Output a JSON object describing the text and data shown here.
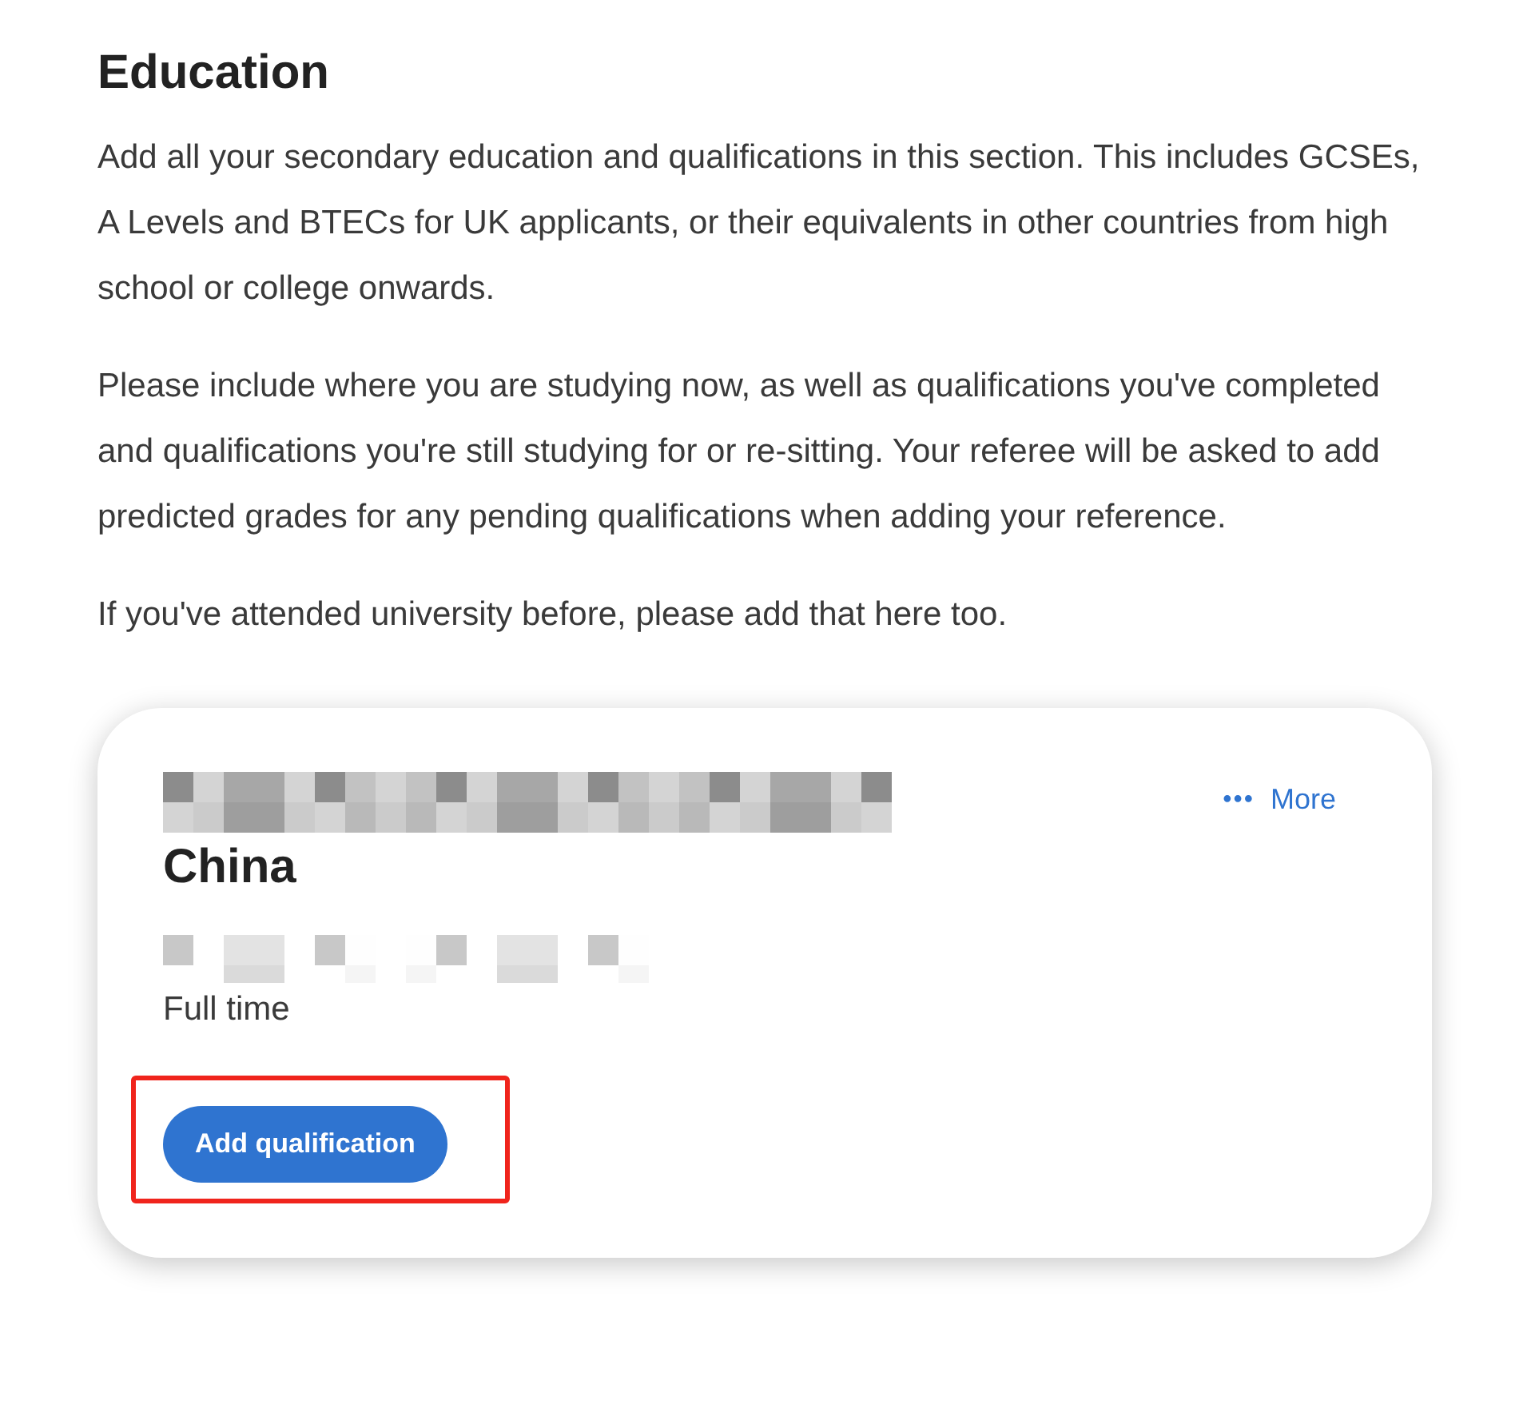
{
  "heading": "Education",
  "paragraphs": [
    "Add all your secondary education and qualifications in this section. This includes GCSEs, A Levels and BTECs for UK applicants, or their equivalents in other countries from high school or college onwards.",
    "Please include where you are studying now, as well as qualifications you've completed and qualifications you're still studying for or re-sitting. Your referee will be asked to add predicted grades for any pending qualifications when adding your reference.",
    "If you've attended university before, please add that here too."
  ],
  "card": {
    "lines": [
      {
        "kind": "redacted-title"
      },
      {
        "kind": "heading",
        "text": "China"
      },
      {
        "kind": "redacted-detail"
      },
      {
        "kind": "text",
        "text": "Full time"
      }
    ],
    "more": {
      "icon": "•••",
      "label": "More"
    },
    "button": {
      "label": "Add qualification",
      "highlighted": true
    }
  }
}
